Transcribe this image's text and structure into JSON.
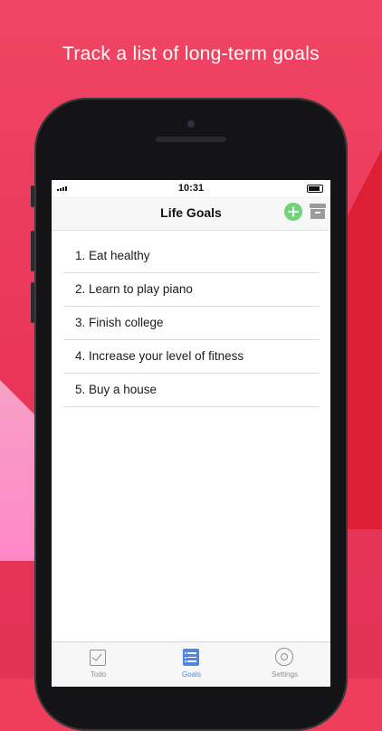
{
  "tagline": "Track a list of long-term goals",
  "status": {
    "time": "10:31"
  },
  "navbar": {
    "title": "Life Goals",
    "add_icon": "plus-circle-icon",
    "archive_icon": "archive-box-icon"
  },
  "goals": [
    "1. Eat healthy",
    "2. Learn to play piano",
    "3. Finish college",
    "4. Increase your level of fitness",
    "5. Buy a house"
  ],
  "tabs": [
    {
      "label": "Todo",
      "icon": "checkbox-icon",
      "active": false
    },
    {
      "label": "Goals",
      "icon": "list-icon",
      "active": true
    },
    {
      "label": "Settings",
      "icon": "gear-icon",
      "active": false
    }
  ],
  "colors": {
    "background": "#ef3e5c",
    "accent": "#4f86e0",
    "add_button": "#6fd47a"
  }
}
